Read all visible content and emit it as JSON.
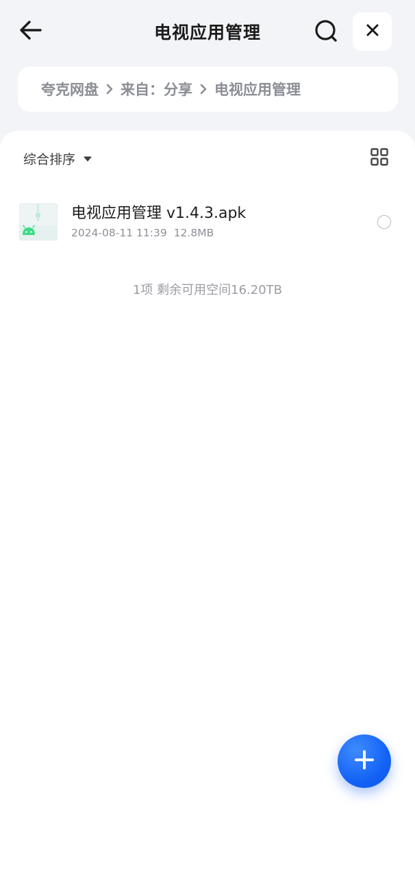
{
  "header": {
    "title": "电视应用管理",
    "back_icon": "arrow-left-icon",
    "search_icon": "search-icon",
    "close_icon": "close-icon"
  },
  "breadcrumb": {
    "items": [
      "夸克网盘",
      "来自：分享",
      "电视应用管理"
    ]
  },
  "toolbar": {
    "sort_label": "综合排序",
    "view_icon": "grid-view-icon"
  },
  "files": [
    {
      "name": "电视应用管理 v1.4.3.apk",
      "date": "2024-08-11 11:39",
      "size": "12.8MB",
      "icon": "apk-android-icon",
      "selected": false
    }
  ],
  "summary": "1项 剩余可用空间16.20TB",
  "fab": {
    "icon": "plus-icon"
  },
  "colors": {
    "background": "#f3f4f7",
    "accent": "#1463f5",
    "android_green": "#3ddc84"
  }
}
